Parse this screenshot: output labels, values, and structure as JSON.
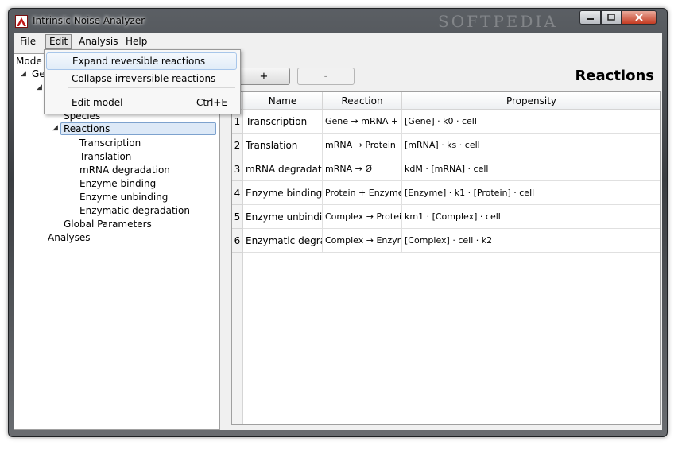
{
  "window": {
    "title": "Intrinsic Noise Analyzer",
    "watermark": "SOFTPEDIA",
    "controls": [
      "minimize-icon",
      "maximize-icon",
      "close-icon"
    ]
  },
  "menubar": {
    "items": [
      "File",
      "Edit",
      "Analysis",
      "Help"
    ],
    "active": "Edit"
  },
  "edit_menu": {
    "items": [
      {
        "label": "Expand reversible reactions",
        "shortcut": ""
      },
      {
        "label": "Collapse irreversible reactions",
        "shortcut": ""
      },
      {
        "label": "Edit model",
        "shortcut": "Ctrl+E"
      }
    ]
  },
  "tree": {
    "header": "Mode",
    "root_partial": "Ge",
    "species": "Species",
    "reactions": "Reactions",
    "reaction_children": [
      "Transcription",
      "Translation",
      "mRNA degradation",
      "Enzyme binding",
      "Enzyme unbinding",
      "Enzymatic degradation"
    ],
    "global_parameters": "Global Parameters",
    "analyses": "Analyses"
  },
  "toolbar": {
    "add_label": "+",
    "remove_label": "-",
    "view_title": "Reactions"
  },
  "table": {
    "columns": [
      "Name",
      "Reaction",
      "Propensity"
    ],
    "rows": [
      {
        "index": "1",
        "name": "Transcription",
        "reaction": "Gene → mRNA + Ge",
        "propensity": "[Gene] · k0 · cell"
      },
      {
        "index": "2",
        "name": "Translation",
        "reaction": "mRNA → Protein + m",
        "propensity": "[mRNA] · ks · cell"
      },
      {
        "index": "3",
        "name": "mRNA degradation",
        "reaction": "mRNA → Ø",
        "propensity": "kdM · [mRNA] · cell"
      },
      {
        "index": "4",
        "name": "Enzyme binding",
        "reaction": "Protein + Enzyme →",
        "propensity": "[Enzyme] · k1 · [Protein] · cell"
      },
      {
        "index": "5",
        "name": "Enzyme unbinding",
        "reaction": "Complex → Protein ·",
        "propensity": "km1 · [Complex] · cell"
      },
      {
        "index": "6",
        "name": "Enzymatic degradati",
        "reaction": "Complex → Enzyme",
        "propensity": "[Complex] · cell · k2"
      }
    ]
  }
}
